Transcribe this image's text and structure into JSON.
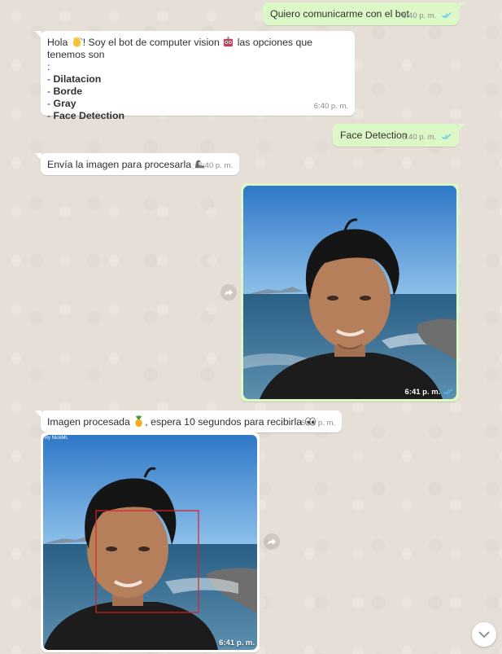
{
  "messages": {
    "m1": {
      "text": "Quiero comunicarme con el bot",
      "time": "6:40 p. m."
    },
    "m2": {
      "line1_a": "Hola ",
      "line1_b": "! Soy el bot de computer vision ",
      "line1_c": " las opciones que tenemos son",
      "line2": ":",
      "options": [
        "Dilatacion",
        "Borde",
        "Gray",
        "Face Detection"
      ],
      "time": "6:40 p. m."
    },
    "m3": {
      "text": "Face Detection",
      "time": "6:40 p. m."
    },
    "m4": {
      "text": "Envía la imagen para procesarla ",
      "time": "6:40 p. m."
    },
    "m5": {
      "time": "6:41 p. m."
    },
    "m6": {
      "text_a": "Imagen procesada ",
      "text_b": ", espera 10 segundos para recibirla ",
      "time": "6:41 p. m."
    },
    "m7": {
      "watermark": "By NickML",
      "time": "6:41 p. m."
    }
  },
  "icons": {
    "tick": "double-check-icon",
    "forward": "forward-icon",
    "scroll": "chevron-down-icon",
    "wave": "waving-hand-emoji",
    "robot": "robot-emoji",
    "arm": "flexed-biceps-emoji",
    "pineapple": "pineapple-emoji",
    "eyes": "eyes-emoji"
  },
  "colors": {
    "outgoing_bubble": "#dcf8c6",
    "incoming_bubble": "#ffffff",
    "read_ticks": "#4fc3f7",
    "face_box": "#e02020"
  }
}
